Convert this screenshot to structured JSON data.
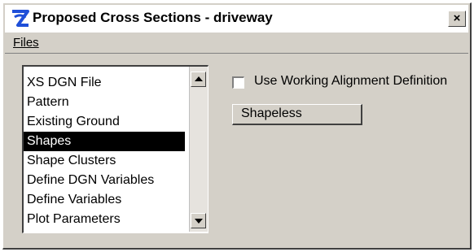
{
  "window": {
    "title": "Proposed Cross Sections - driveway",
    "close_label": "×"
  },
  "menubar": {
    "files_label": "Files"
  },
  "list": {
    "items": [
      "XS DGN File",
      "Pattern",
      "Existing Ground",
      "Shapes",
      "Shape Clusters",
      "Define DGN Variables",
      "Define Variables",
      "Plot Parameters"
    ],
    "selected": "Shapes"
  },
  "options": {
    "use_working_alignment_label": "Use Working Alignment Definition",
    "use_working_alignment_checked": false,
    "shape_type_value": "Shapeless"
  },
  "colors": {
    "selection_bg": "#000000",
    "dialog_bg": "#d4d0c8",
    "icon_blue": "#1f4fd8"
  }
}
